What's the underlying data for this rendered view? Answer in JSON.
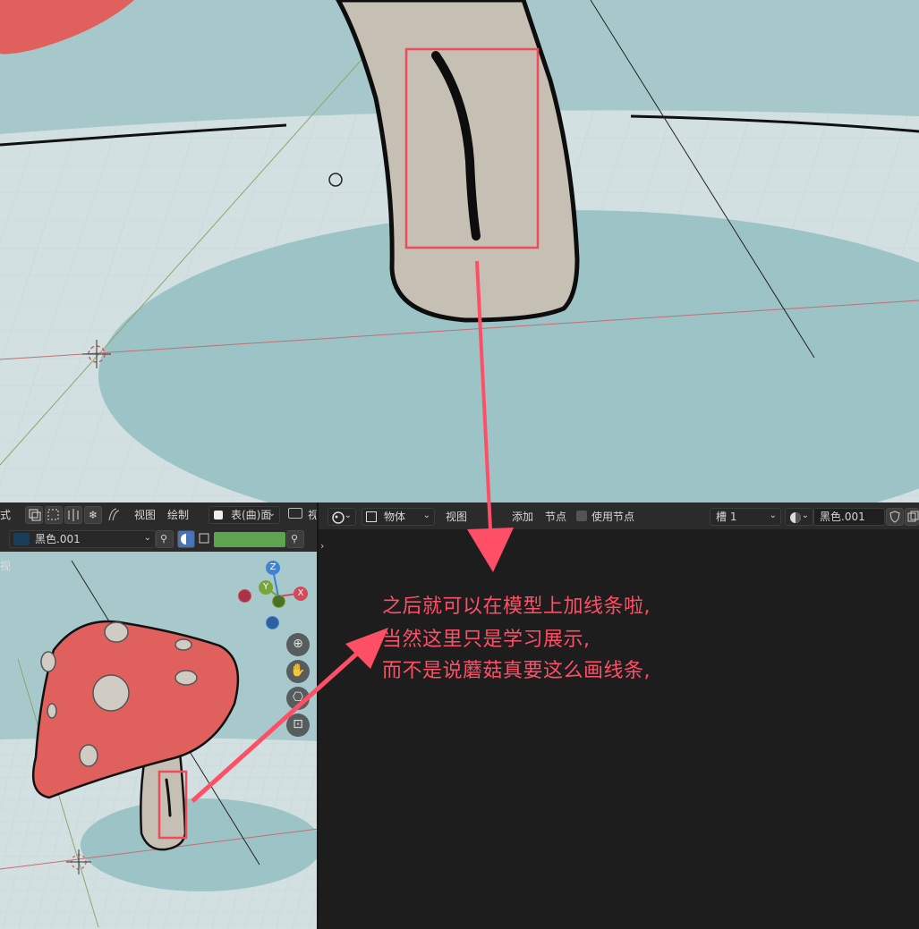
{
  "top_viewport": {},
  "left_viewport": {
    "header": {
      "mode_cut_text": "式",
      "view_menu": "视图",
      "paint_menu": "绘制",
      "surface_dropdown": "表(曲)面",
      "overflow_text": "视"
    },
    "material_row": {
      "material_name": "黑色.001"
    },
    "corner_label": "视",
    "gizmo": {
      "z": "Z",
      "y": "Y",
      "x": "X"
    }
  },
  "shader_editor": {
    "header": {
      "object_dropdown": "物体",
      "view_menu": "视图",
      "add_menu": "添加",
      "node_menu": "节点",
      "use_nodes_label": "使用节点",
      "slot_dropdown": "槽 1",
      "material_field": "黑色.001"
    }
  },
  "annotation": {
    "lines": [
      "之后就可以在模型上加线条啦,",
      "当然这里只是学习展示,",
      "而不是说蘑菇真要这么画线条,"
    ],
    "color": "#ff4f66"
  },
  "colors": {
    "ground_light": "#d6e2e4",
    "ground_teal": "#9fc4c8",
    "stem": "#c6c0b4",
    "cap_red": "#e0605d",
    "highlight_box": "#ef4b5a",
    "panel_bg": "#1d1d1d",
    "header_bg": "#2b2b2b"
  }
}
